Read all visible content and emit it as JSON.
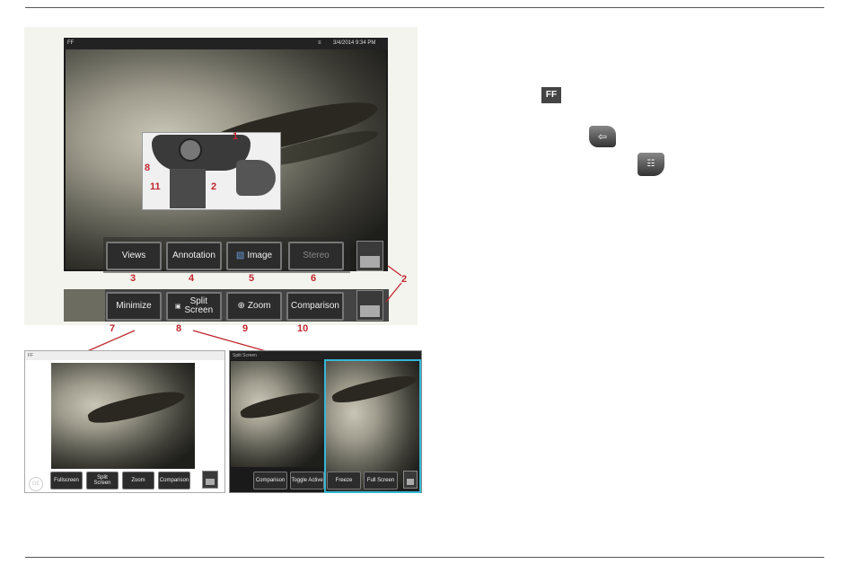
{
  "main_screen": {
    "status_mode": "FF",
    "status_datetime": "3/4/2014  9:34 PM",
    "menu_buttons": [
      {
        "label": "Views",
        "callout": "3",
        "disabled": false
      },
      {
        "label": "Annotation",
        "callout": "4",
        "disabled": false
      },
      {
        "label": "Image",
        "callout": "5",
        "disabled": false
      },
      {
        "label": "Stereo",
        "callout": "6",
        "disabled": true
      }
    ],
    "submenu_buttons": [
      {
        "label": "Minimize",
        "callout": "7"
      },
      {
        "label": "Split Screen",
        "label_line1": "Split",
        "label_line2": "Screen",
        "callout": "8"
      },
      {
        "label": "Zoom",
        "callout": "9"
      },
      {
        "label": "Comparison",
        "callout": "10"
      }
    ],
    "softkey_callout": "2",
    "inset_callouts": [
      "1",
      "8",
      "11",
      "2"
    ]
  },
  "minimized_screen": {
    "status_mode": "FF",
    "buttons": [
      {
        "label": "Fullscreen"
      },
      {
        "label": "Split Screen",
        "label_line1": "Split",
        "label_line2": "Screen"
      },
      {
        "label": "Zoom"
      },
      {
        "label": "Comparison"
      }
    ]
  },
  "split_screen": {
    "status_mode": "Split Screen",
    "buttons": [
      {
        "label": "Comparison"
      },
      {
        "label": "Toggle Active"
      },
      {
        "label": "Freeze"
      },
      {
        "label": "Full Screen"
      }
    ]
  },
  "inline_icons": {
    "ff_icon": "FF"
  },
  "colors": {
    "callout_red": "#c0272d",
    "split_border": "#35b6d6"
  }
}
